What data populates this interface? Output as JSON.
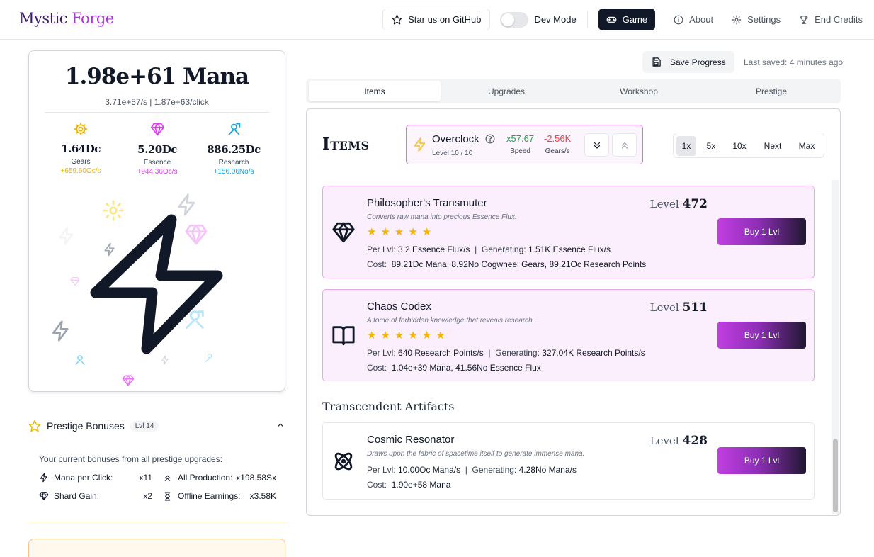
{
  "app": {
    "logo_part1": "Mystic",
    "logo_part2": "Forge"
  },
  "nav": {
    "github_label": "Star us on GitHub",
    "dev_mode_label": "Dev Mode",
    "dev_mode_on": false,
    "game_label": "Game",
    "about_label": "About",
    "settings_label": "Settings",
    "credits_label": "End Credits"
  },
  "stats": {
    "mana_title": "1.98e+61 Mana",
    "mana_rate": "3.71e+57/s  |  1.87e+63/click",
    "resources": [
      {
        "name": "Gears",
        "value": "1.64Dc",
        "rate": "+659.60Oc/s",
        "color": "#eab308",
        "icon": "gear-icon"
      },
      {
        "name": "Essence",
        "value": "5.20Dc",
        "rate": "+944.36Oc/s",
        "color": "#d946ef",
        "icon": "gem-icon"
      },
      {
        "name": "Research",
        "value": "886.25Dc",
        "rate": "+156.06No/s",
        "color": "#0ea5e9",
        "icon": "research-icon"
      }
    ]
  },
  "prestige": {
    "title": "Prestige Bonuses",
    "level": "Lvl 14",
    "intro": "Your current bonuses from all prestige upgrades:",
    "bonuses": [
      {
        "label": "Mana per Click:",
        "value": "x11"
      },
      {
        "label": "All Production:",
        "value": "x198.58Sx"
      },
      {
        "label": "Shard Gain:",
        "value": "x2"
      },
      {
        "label": "Offline Earnings:",
        "value": "x3.58K"
      }
    ]
  },
  "save": {
    "button_label": "Save Progress",
    "last_saved": "Last saved: 4 minutes ago"
  },
  "tabs": [
    {
      "label": "Items",
      "active": true
    },
    {
      "label": "Upgrades",
      "active": false
    },
    {
      "label": "Workshop",
      "active": false
    },
    {
      "label": "Prestige",
      "active": false
    }
  ],
  "items_panel": {
    "title": "Items",
    "overclock": {
      "name": "Overclock",
      "level": "Level 10 / 10",
      "speed_value": "x57.67",
      "speed_label": "Speed",
      "gears_value": "-2.56K",
      "gears_label": "Gears/s"
    },
    "multipliers": [
      {
        "label": "1x",
        "active": true
      },
      {
        "label": "5x",
        "active": false
      },
      {
        "label": "10x",
        "active": false
      },
      {
        "label": "Next",
        "active": false
      },
      {
        "label": "Max",
        "active": false
      }
    ],
    "items": [
      {
        "name": "Philosopher's Transmuter",
        "description": "Converts raw mana into precious Essence Flux.",
        "level_label": "Level",
        "level": "472",
        "stars": 5,
        "per_lvl_label": "Per Lvl:",
        "per_lvl": "3.2 Essence Flux/s",
        "generating_label": "Generating:",
        "generating": "1.51K Essence Flux/s",
        "cost_label": "Cost:",
        "cost": "89.21Dc Mana,  8.92No Cogwheel Gears,  89.21Oc Research Points",
        "buy_label": "Buy 1 Lvl",
        "icon": "gem-icon"
      },
      {
        "name": "Chaos Codex",
        "description": "A tome of forbidden knowledge that reveals research.",
        "level_label": "Level",
        "level": "511",
        "stars": 6,
        "per_lvl_label": "Per Lvl:",
        "per_lvl": "640 Research Points/s",
        "generating_label": "Generating:",
        "generating": "327.04K Research Points/s",
        "cost_label": "Cost:",
        "cost": "1.04e+39 Mana,  41.56No Essence Flux",
        "buy_label": "Buy 1 Lvl",
        "icon": "book-icon"
      }
    ],
    "section_title": "Transcendent Artifacts",
    "artifacts": [
      {
        "name": "Cosmic Resonator",
        "description": "Draws upon the fabric of spacetime itself to generate immense mana.",
        "level_label": "Level",
        "level": "428",
        "per_lvl_label": "Per Lvl:",
        "per_lvl": "10.00Oc Mana/s",
        "generating_label": "Generating:",
        "generating": "4.28No Mana/s",
        "cost_label": "Cost:",
        "cost": "1.90e+58 Mana",
        "buy_label": "Buy 1 Lvl",
        "icon": "atom-icon"
      }
    ]
  }
}
